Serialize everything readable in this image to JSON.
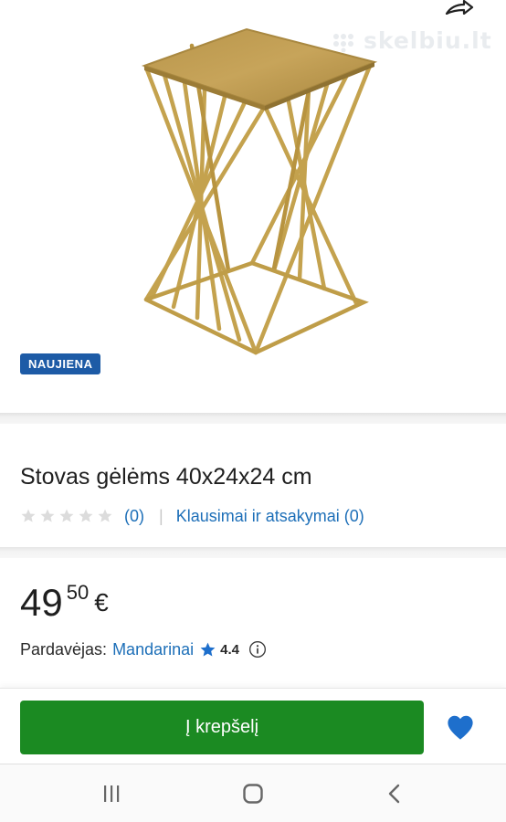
{
  "watermark": "skelbiu.lt",
  "badge": "NAUJIENA",
  "product": {
    "title": "Stovas gėlėms 40x24x24 cm",
    "rating_stars": 0,
    "reviews_count": "(0)",
    "separator": "|",
    "qa_link": "Klausimai ir atsakymai (0)"
  },
  "price": {
    "integer": "49",
    "decimal": "50",
    "currency": "€"
  },
  "seller": {
    "label": "Pardavėjas:",
    "name": "Mandarinai",
    "rating": "4.4"
  },
  "actions": {
    "cart_label": "Į krepšelį"
  },
  "icons": {
    "share": "share-icon",
    "star_empty": "star-empty-icon",
    "star_filled": "star-icon",
    "info": "info-icon",
    "heart": "heart-icon",
    "nav_recent": "recent-apps-icon",
    "nav_home": "home-icon",
    "nav_back": "back-icon"
  },
  "colors": {
    "badge_bg": "#1d5ba6",
    "link": "#1d6fb8",
    "cart_button": "#1b8a22",
    "heart": "#1e6fcc",
    "product_gold": "#c9a548"
  }
}
